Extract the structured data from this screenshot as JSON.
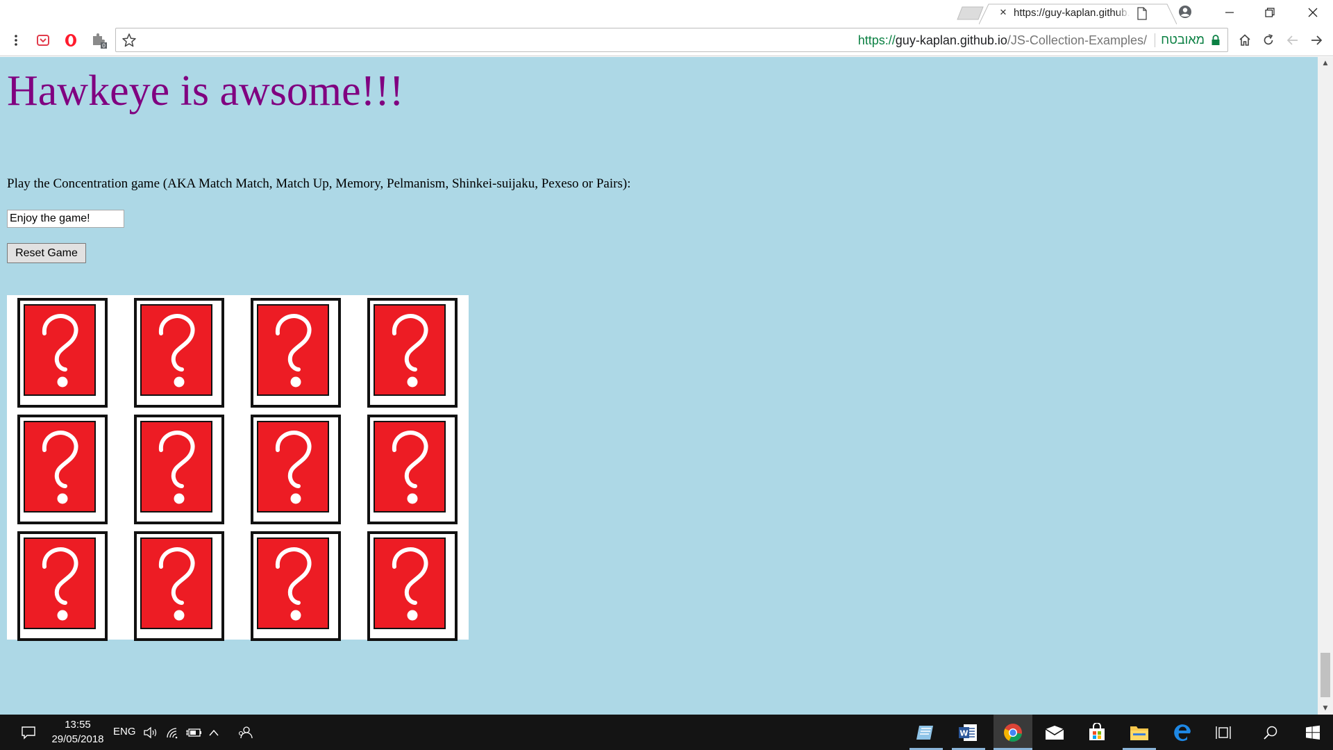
{
  "browser": {
    "tab_title": "https://guy-kaplan.github.io/JS-Collection-Examples/",
    "url_scheme": "https://",
    "url_host": "guy-kaplan.github.io",
    "url_path": "/JS-Collection-Examples/",
    "security_label": "מאובטח",
    "extension_badge": "0"
  },
  "page": {
    "title": "Hawkeye is awsome!!!",
    "intro": "Play the Concentration game (AKA Match Match, Match Up, Memory, Pelmanism, Shinkei-suijaku, Pexeso or Pairs):",
    "message_value": "Enjoy the game!",
    "reset_label": "Reset Game",
    "card_back_icon": "question-mark-icon",
    "card_rows": 3,
    "card_cols": 4,
    "colors": {
      "background": "#add8e6",
      "title": "#800080",
      "card_back": "#ed1c24"
    }
  },
  "taskbar": {
    "time": "13:55",
    "date": "29/05/2018",
    "language": "ENG"
  }
}
